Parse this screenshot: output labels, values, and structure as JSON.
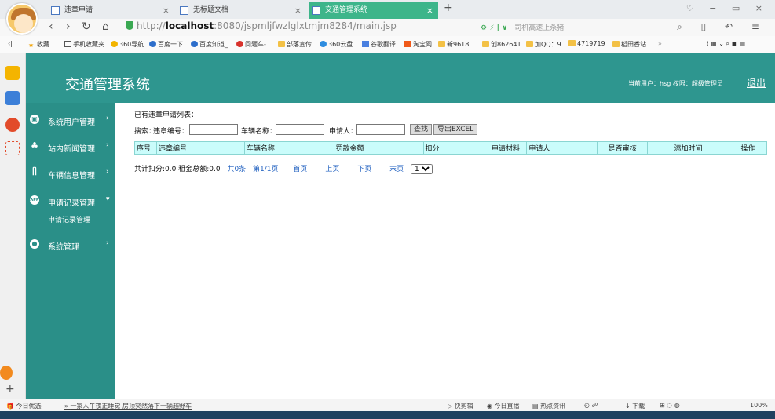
{
  "browser": {
    "tabs": [
      {
        "label": "违章申请"
      },
      {
        "label": "无标题文档"
      },
      {
        "label": "交通管理系统"
      }
    ],
    "new_tab": "+",
    "url_prefix": "http://",
    "url_host": "localhost",
    "url_rest": ":8080/jspmljfwzlglxtmjm8284/main.jsp",
    "search_hint": "司机高速上杀猪",
    "bookmarks": [
      {
        "label": "收藏"
      },
      {
        "label": "手机收藏夹"
      },
      {
        "label": "360导航"
      },
      {
        "label": "百度一下"
      },
      {
        "label": "百度知道_"
      },
      {
        "label": "问题车-"
      },
      {
        "label": "部落宣传"
      },
      {
        "label": "360云盘"
      },
      {
        "label": "谷歌翻译"
      },
      {
        "label": "淘宝网"
      },
      {
        "label": "新9618"
      },
      {
        "label": "创862641"
      },
      {
        "label": "加QQ：9"
      },
      {
        "label": "4719719"
      },
      {
        "label": "稻田香站"
      }
    ]
  },
  "app": {
    "title": "交通管理系统",
    "user_info": "当前用户：hsg  权限：超级管理员",
    "logout": "退出"
  },
  "menu": [
    {
      "label": "系统用户管理"
    },
    {
      "label": "站内新闻管理"
    },
    {
      "label": "车辆信息管理"
    },
    {
      "label": "申请记录管理"
    },
    {
      "label": "系统管理"
    }
  ],
  "menu_sub": "申请记录管理",
  "content": {
    "list_title": "已有违章申请列表：",
    "search_label": "搜索：",
    "field_violation_no": "违章编号：",
    "field_vehicle_name": "车辆名称：",
    "field_applicant": "申请人：",
    "search_button": "查找",
    "export_button": "导出EXCEL",
    "columns": [
      "序号",
      "违章编号",
      "车辆名称",
      "罚款金额",
      "扣分",
      "申请材料",
      "申请人",
      "是否审核",
      "添加时间",
      "操作"
    ],
    "summary": "共计扣分:0.0  租金总额:0.0",
    "total": "共0条",
    "page_info": "第1/1页",
    "first": "首页",
    "prev": "上页",
    "next": "下页",
    "last": "末页",
    "page_select": "1"
  },
  "status": {
    "left": "今日优选",
    "news": "一家人午夜正睡觉 房顶突然落下一辆越野车",
    "items": [
      "快剪辑",
      "今日直播",
      "热点资讯",
      "下载"
    ],
    "zoom": "100%"
  }
}
